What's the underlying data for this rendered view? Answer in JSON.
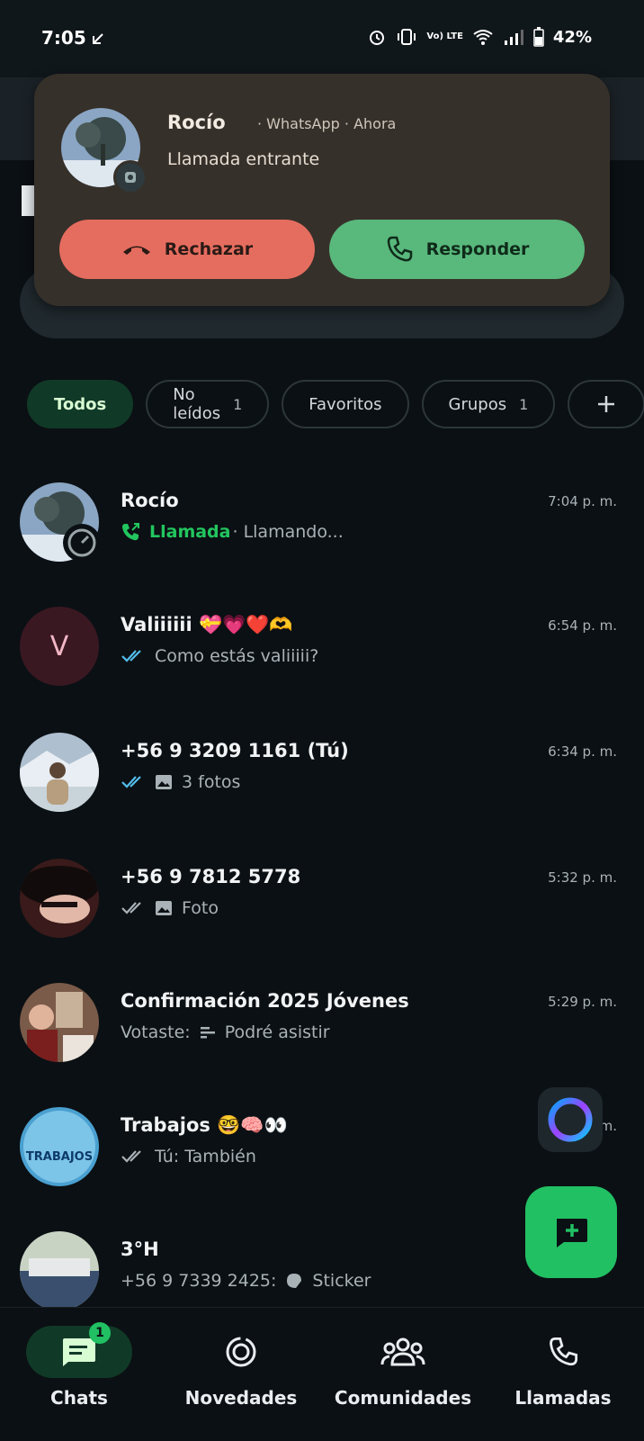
{
  "status_bar": {
    "time": "7:05",
    "battery": "42%",
    "volte_label": "Vo) LTE"
  },
  "notification": {
    "caller": "Rocío",
    "meta": "· WhatsApp · Ahora",
    "text": "Llamada entrante",
    "reject_label": "Rechazar",
    "accept_label": "Responder"
  },
  "filters": [
    {
      "label": "Todos",
      "count": ""
    },
    {
      "label": "No leídos",
      "count": "1"
    },
    {
      "label": "Favoritos",
      "count": ""
    },
    {
      "label": "Grupos",
      "count": "1"
    }
  ],
  "chats": [
    {
      "name": "Rocío",
      "time": "7:04 p. m.",
      "preview_prefix": "Llamada",
      "preview": "· Llamando..."
    },
    {
      "name": "Valiiiiii 💝💗❤️🫶",
      "time": "6:54 p. m.",
      "preview": "Como estás valiiiii?"
    },
    {
      "name": "+56 9 3209 1161 (Tú)",
      "time": "6:34 p. m.",
      "preview": "3 fotos"
    },
    {
      "name": "+56 9 7812 5778",
      "time": "5:32 p. m.",
      "preview": "Foto"
    },
    {
      "name": "Confirmación 2025 Jóvenes",
      "time": "5:29 p. m.",
      "preview_prefix": "Votaste:",
      "preview": "Podré asistir"
    },
    {
      "name": "Trabajos 🤓🧠👀",
      "time": "m.",
      "preview": "Tú: También"
    },
    {
      "name": "3°H",
      "time": "",
      "preview_prefix": "+56 9 7339 2425:",
      "preview": "Sticker"
    }
  ],
  "avatar_letters": {
    "vali": "V",
    "trabajos": "TRABAJOS"
  },
  "bottom_nav": [
    {
      "label": "Chats",
      "badge": "1"
    },
    {
      "label": "Novedades"
    },
    {
      "label": "Comunidades"
    },
    {
      "label": "Llamadas"
    }
  ],
  "colors": {
    "accent": "#21c063",
    "background": "#0b1014",
    "reject": "#e56d5f",
    "accept": "#59b87c"
  }
}
